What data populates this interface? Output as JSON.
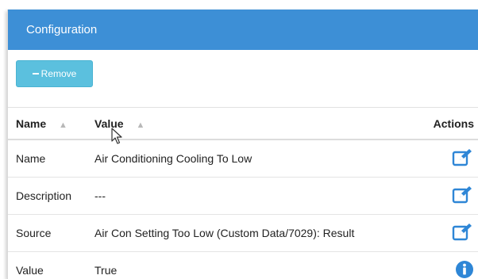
{
  "panel": {
    "title": "Configuration"
  },
  "toolbar": {
    "remove_label": "Remove"
  },
  "table": {
    "columns": {
      "name": "Name",
      "value": "Value",
      "actions": "Actions"
    },
    "rows": [
      {
        "name": "Name",
        "value": "Air Conditioning Cooling To Low",
        "action_icon": "edit-icon"
      },
      {
        "name": "Description",
        "value": "---",
        "action_icon": "edit-icon"
      },
      {
        "name": "Source",
        "value": "Air Con Setting Too Low (Custom Data/7029): Result",
        "action_icon": "edit-icon"
      },
      {
        "name": "Value",
        "value": "True",
        "action_icon": "info-icon"
      }
    ]
  },
  "colors": {
    "header": "#3d8fd6",
    "button": "#5bc0de",
    "icon": "#2e86d6"
  }
}
